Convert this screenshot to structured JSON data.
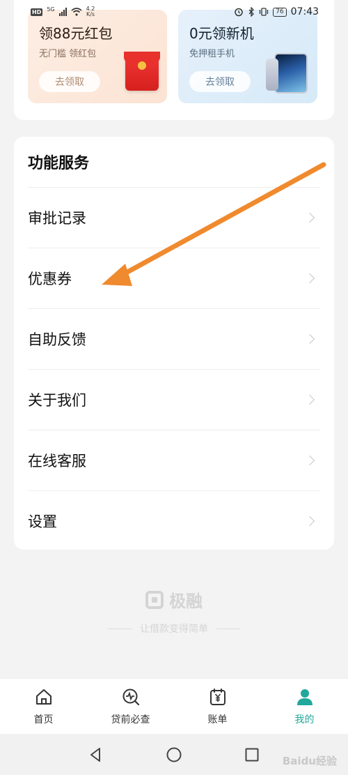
{
  "status_bar": {
    "hd": "HD",
    "network": "5G",
    "speed_value": "4.2",
    "speed_unit": "K/s",
    "battery": "76",
    "time": "07:43"
  },
  "promos": [
    {
      "title": "领88元红包",
      "subtitle": "无门槛 领红包",
      "button": "去领取"
    },
    {
      "title": "0元领新机",
      "subtitle": "免押租手机",
      "button": "去领取"
    }
  ],
  "services": {
    "title": "功能服务",
    "items": [
      {
        "label": "审批记录"
      },
      {
        "label": "优惠券"
      },
      {
        "label": "自助反馈"
      },
      {
        "label": "关于我们"
      },
      {
        "label": "在线客服"
      },
      {
        "label": "设置"
      }
    ]
  },
  "brand": {
    "name": "极融",
    "slogan": "让借款变得简单"
  },
  "tabbar": {
    "items": [
      {
        "label": "首页",
        "icon": "home-icon"
      },
      {
        "label": "贷前必查",
        "icon": "pulse-search-icon"
      },
      {
        "label": "账单",
        "icon": "bill-icon"
      },
      {
        "label": "我的",
        "icon": "user-icon",
        "active": true
      }
    ],
    "active_color": "#22a89a"
  },
  "watermark": "Baidu经验",
  "colors": {
    "annotation_arrow": "#f08a2e",
    "background": "#f3f3f3"
  }
}
